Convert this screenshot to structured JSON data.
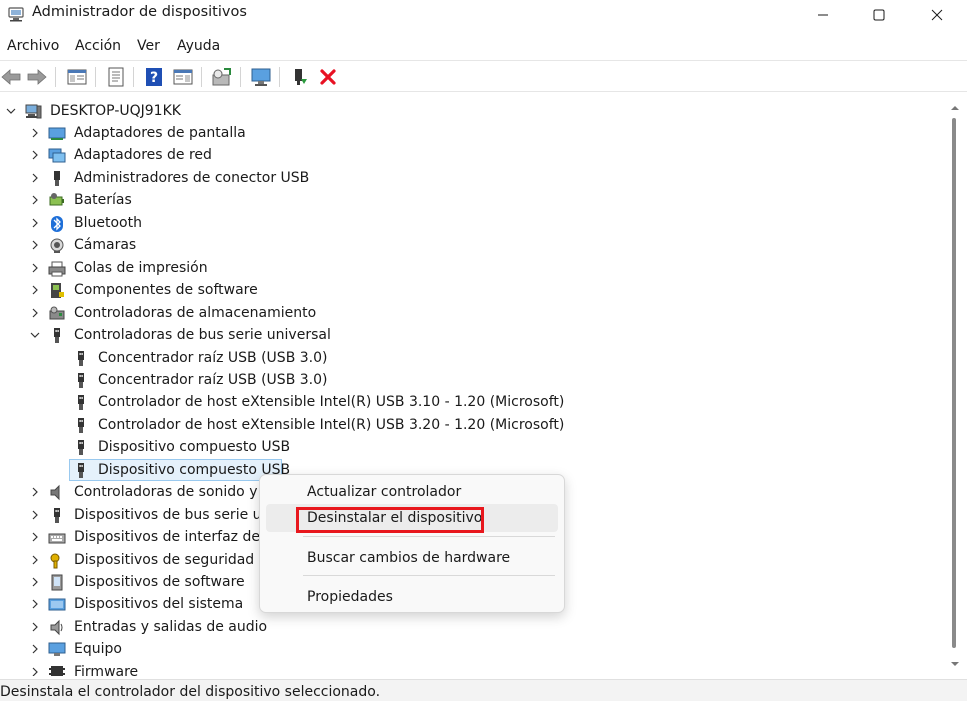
{
  "window": {
    "title": "Administrador de dispositivos",
    "controls": [
      "minimize-icon",
      "maximize-icon",
      "close-icon"
    ]
  },
  "menu": [
    {
      "label": "Archivo"
    },
    {
      "label": "Acción"
    },
    {
      "label": "Ver"
    },
    {
      "label": "Ayuda"
    }
  ],
  "toolbar": {
    "buttons": [
      "back-arrow-icon",
      "forward-arrow-icon",
      "show-hide-console-tree-icon",
      "properties-icon",
      "help-icon",
      "action-pane-icon",
      "scan-hardware-icon",
      "monitor-icon",
      "enable-device-icon",
      "uninstall-red-x-icon"
    ]
  },
  "tree": {
    "root": "DESKTOP-UQJ91KK",
    "items": [
      {
        "label": "Adaptadores de pantalla",
        "icon": "display-adapter-icon",
        "expanded": false
      },
      {
        "label": "Adaptadores de red",
        "icon": "network-adapter-icon",
        "expanded": false
      },
      {
        "label": "Administradores de conector USB",
        "icon": "usb-connector-icon",
        "expanded": false
      },
      {
        "label": "Baterías",
        "icon": "battery-icon",
        "expanded": false
      },
      {
        "label": "Bluetooth",
        "icon": "bluetooth-icon",
        "expanded": false
      },
      {
        "label": "Cámaras",
        "icon": "camera-icon",
        "expanded": false
      },
      {
        "label": "Colas de impresión",
        "icon": "printer-icon",
        "expanded": false
      },
      {
        "label": "Componentes de software",
        "icon": "software-component-icon",
        "expanded": false
      },
      {
        "label": "Controladoras de almacenamiento",
        "icon": "storage-controller-icon",
        "expanded": false
      },
      {
        "label": "Controladoras de bus serie universal",
        "icon": "usb-icon",
        "expanded": true
      },
      {
        "label": "Concentrador raíz USB (USB 3.0)",
        "icon": "usb-icon",
        "child": true
      },
      {
        "label": "Concentrador raíz USB (USB 3.0)",
        "icon": "usb-icon",
        "child": true
      },
      {
        "label": "Controlador de host eXtensible Intel(R) USB 3.10 - 1.20 (Microsoft)",
        "icon": "usb-icon",
        "child": true
      },
      {
        "label": "Controlador de host eXtensible Intel(R) USB 3.20 - 1.20 (Microsoft)",
        "icon": "usb-icon",
        "child": true
      },
      {
        "label": "Dispositivo compuesto USB",
        "icon": "usb-icon",
        "child": true
      },
      {
        "label": "Dispositivo compuesto USB",
        "icon": "usb-icon",
        "child": true,
        "selected": true
      },
      {
        "label": "Controladoras de sonido y v",
        "icon": "sound-icon",
        "expanded": false
      },
      {
        "label": "Dispositivos de bus serie uni",
        "icon": "usb-icon",
        "expanded": false
      },
      {
        "label": "Dispositivos de interfaz de u",
        "icon": "hid-keyboard-icon",
        "expanded": false
      },
      {
        "label": "Dispositivos de seguridad",
        "icon": "security-key-icon",
        "expanded": false
      },
      {
        "label": "Dispositivos de software",
        "icon": "software-device-icon",
        "expanded": false
      },
      {
        "label": "Dispositivos del sistema",
        "icon": "system-device-icon",
        "expanded": false
      },
      {
        "label": "Entradas y salidas de audio",
        "icon": "speaker-icon",
        "expanded": false
      },
      {
        "label": "Equipo",
        "icon": "computer-icon",
        "expanded": false
      },
      {
        "label": "Firmware",
        "icon": "firmware-icon",
        "expanded": false
      }
    ]
  },
  "context_menu": {
    "items": [
      {
        "label": "Actualizar controlador"
      },
      {
        "label": "Desinstalar el dispositivo",
        "highlighted": true
      },
      {
        "label": "Buscar cambios de hardware"
      },
      {
        "label": "Propiedades"
      }
    ]
  },
  "status": {
    "text": "Desinstala el controlador del dispositivo seleccionado."
  },
  "colors": {
    "selection_fill": "#e5f1fb",
    "selection_border": "#99c9ef",
    "highlight_red": "#e8171d",
    "uninstall_red": "#e81123",
    "help_blue": "#1f4fb4"
  }
}
